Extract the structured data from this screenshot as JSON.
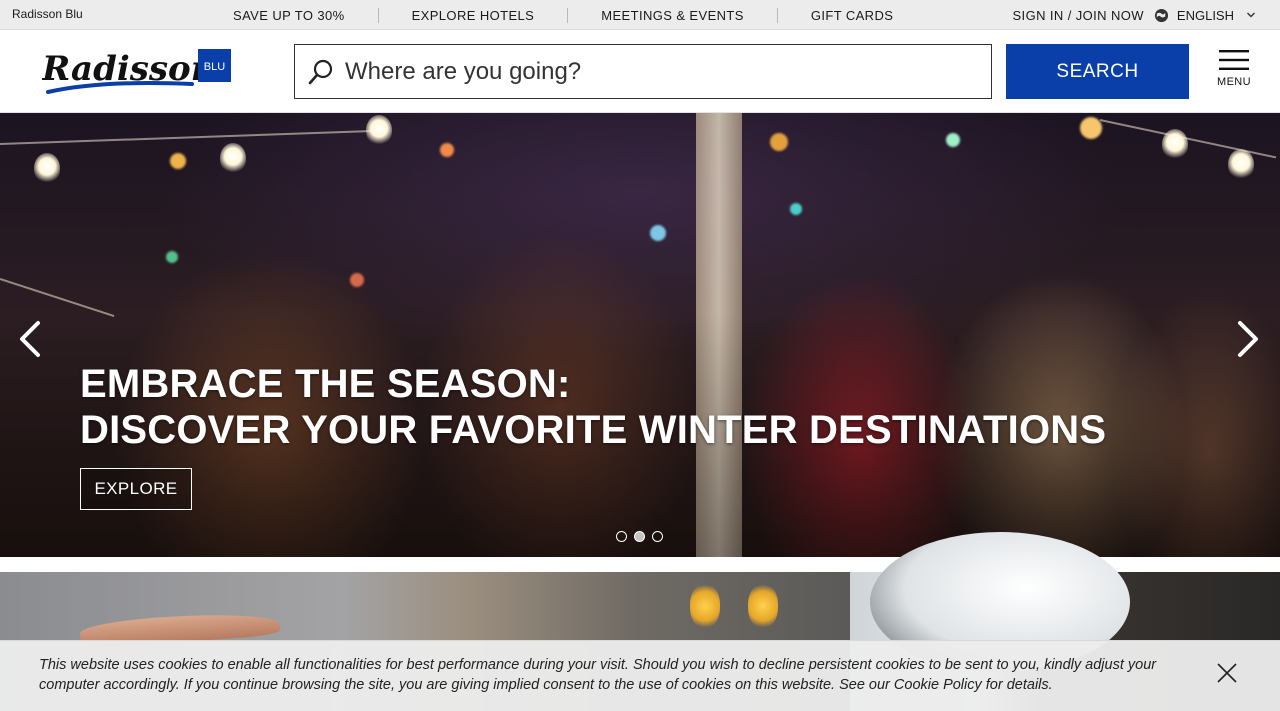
{
  "topbar": {
    "brand": "Radisson Blu",
    "nav": [
      "SAVE UP TO 30%",
      "EXPLORE HOTELS",
      "MEETINGS & EVENTS",
      "GIFT CARDS"
    ],
    "sign_in": "SIGN IN / JOIN NOW",
    "language": "ENGLISH"
  },
  "header": {
    "logo_text": "Radisson",
    "logo_badge": "BLU",
    "search_placeholder": "Where are you going?",
    "search_button": "SEARCH",
    "menu_label": "MENU"
  },
  "hero": {
    "title_line1": "EMBRACE THE SEASON:",
    "title_line2": "DISCOVER YOUR FAVORITE WINTER DESTINATIONS",
    "cta": "EXPLORE",
    "slide_count": 3,
    "active_slide": 2
  },
  "cookie": {
    "text": "This website uses cookies to enable all functionalities for best performance during your visit. Should you wish to decline persistent cookies to be sent to you, kindly adjust your computer accordingly. If you continue browsing the site, you are giving implied consent to the use of cookies on this website. See our ",
    "link": "Cookie Policy",
    "suffix": " for details."
  },
  "colors": {
    "brand_blue": "#0a3ea8",
    "topbar_bg": "#ececec"
  },
  "icons": [
    "globe-icon",
    "chevron-down-icon",
    "search-icon",
    "hamburger-icon",
    "chevron-left-icon",
    "chevron-right-icon",
    "close-icon"
  ]
}
